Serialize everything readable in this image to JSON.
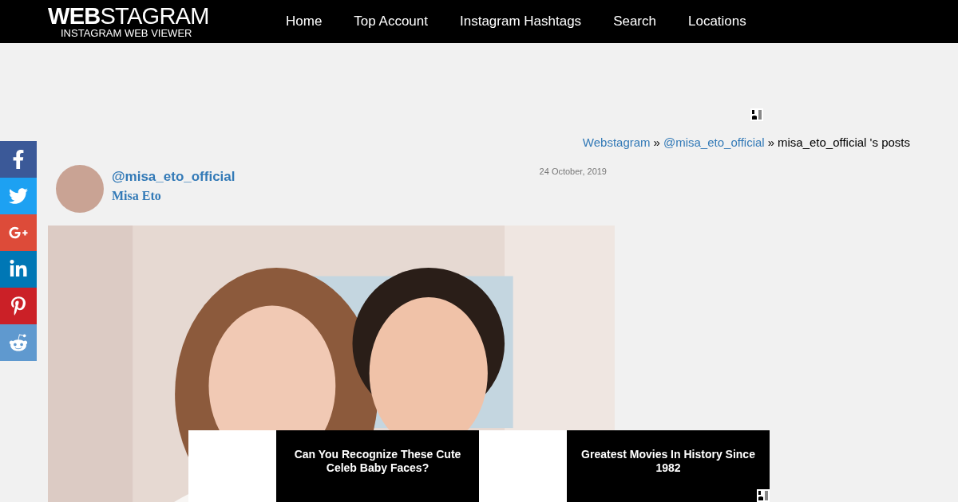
{
  "header": {
    "logo": {
      "bold": "WEB",
      "rest": "STAGRAM",
      "tagline": "INSTAGRAM WEB VIEWER"
    },
    "nav": [
      {
        "label": "Home"
      },
      {
        "label": "Top Account"
      },
      {
        "label": "Instagram Hashtags"
      },
      {
        "label": "Search"
      },
      {
        "label": "Locations"
      }
    ]
  },
  "share_bar": [
    {
      "kind": "facebook",
      "color": "#3b5998"
    },
    {
      "kind": "twitter",
      "color": "#1da1f2"
    },
    {
      "kind": "googleplus",
      "color": "#dd4b39"
    },
    {
      "kind": "linkedin",
      "color": "#0077b5"
    },
    {
      "kind": "pinterest",
      "color": "#cb2027"
    },
    {
      "kind": "reddit",
      "color": "#5f99cf"
    }
  ],
  "breadcrumb": [
    {
      "kind": "link",
      "text": "Webstagram"
    },
    {
      "kind": "separator",
      "text": "»"
    },
    {
      "kind": "link",
      "text": "@misa_eto_official"
    },
    {
      "kind": "separator",
      "text": "»"
    },
    {
      "kind": "current",
      "text": "misa_eto_official 's posts"
    }
  ],
  "post": {
    "username": "@misa_eto_official",
    "full_name": "Misa Eto",
    "date": "24 October, 2019"
  },
  "ads": [
    {
      "title": "Can You Recognize These Cute Celeb Baby Faces?",
      "badge": false
    },
    {
      "title": "Greatest Movies In History Since 1982",
      "badge": true
    }
  ]
}
